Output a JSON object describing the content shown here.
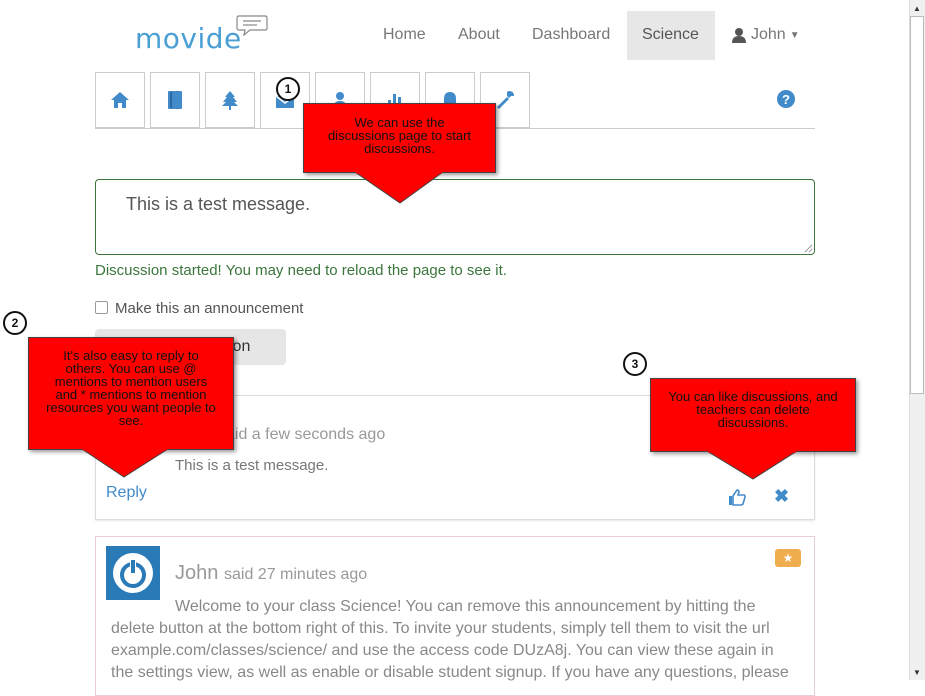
{
  "brand": {
    "logo_text": "movide"
  },
  "nav": {
    "home": "Home",
    "about": "About",
    "dashboard": "Dashboard",
    "science": "Science",
    "user": "John"
  },
  "form": {
    "message_value": "This is a test message.",
    "status_text": "Discussion started! You may need to reload the page to see it.",
    "announcement_label": "Make this an announcement",
    "start_button_label": "ssion"
  },
  "post1": {
    "said": "aid a few seconds ago",
    "body": "This is a test message.",
    "reply_label": "Reply"
  },
  "post2": {
    "author": "John",
    "said": "said 27 minutes ago",
    "body_lines": [
      "Welcome to your class Science! You can remove this announcement by hitting the",
      "delete button at the bottom right of this. To invite your students, simply tell them to visit the url",
      "example.com/classes/science/ and use the access code DUzA8j. You can view these again in",
      "the settings view, as well as enable or disable student signup. If you have any questions, please"
    ]
  },
  "callouts": {
    "one": {
      "number": "1",
      "text": "We can use the discussions page to start discussions."
    },
    "two": {
      "number": "2",
      "text": "It's also easy to reply to others. You can use @ mentions to mention users and * mentions to mention resources you want people to see."
    },
    "three": {
      "number": "3",
      "text": "You can like discussions, and teachers can delete discussions."
    }
  },
  "colors": {
    "accent": "#428bca",
    "success": "#3c763d",
    "callout": "#ff0000",
    "star": "#f0ad4e"
  }
}
